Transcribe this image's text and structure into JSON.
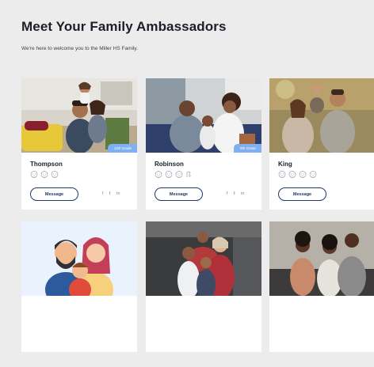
{
  "page": {
    "title": "Meet Your Family Ambassadors",
    "subtitle": "We're here to welcome you to the Miller HS Family."
  },
  "cards": [
    {
      "name": "Thompson",
      "grade": "11th Grade",
      "message_label": "Message",
      "icons": [
        "child-face-icon",
        "child-face-icon",
        "child-face-icon"
      ]
    },
    {
      "name": "Robinson",
      "grade": "9th Grade",
      "message_label": "Message",
      "icons": [
        "child-face-icon",
        "child-face-icon",
        "child-face-icon",
        "dog-icon"
      ]
    },
    {
      "name": "King",
      "grade": "",
      "message_label": "Message",
      "icons": [
        "child-face-icon",
        "child-face-icon",
        "child-face-icon",
        "child-face-icon"
      ]
    }
  ],
  "social": {
    "facebook": "f",
    "twitter": "𝕥",
    "linkedin": "in"
  },
  "colors": {
    "background": "#ececec",
    "accent_blue": "#7fb0f2",
    "button_navy": "#1f3a68"
  }
}
